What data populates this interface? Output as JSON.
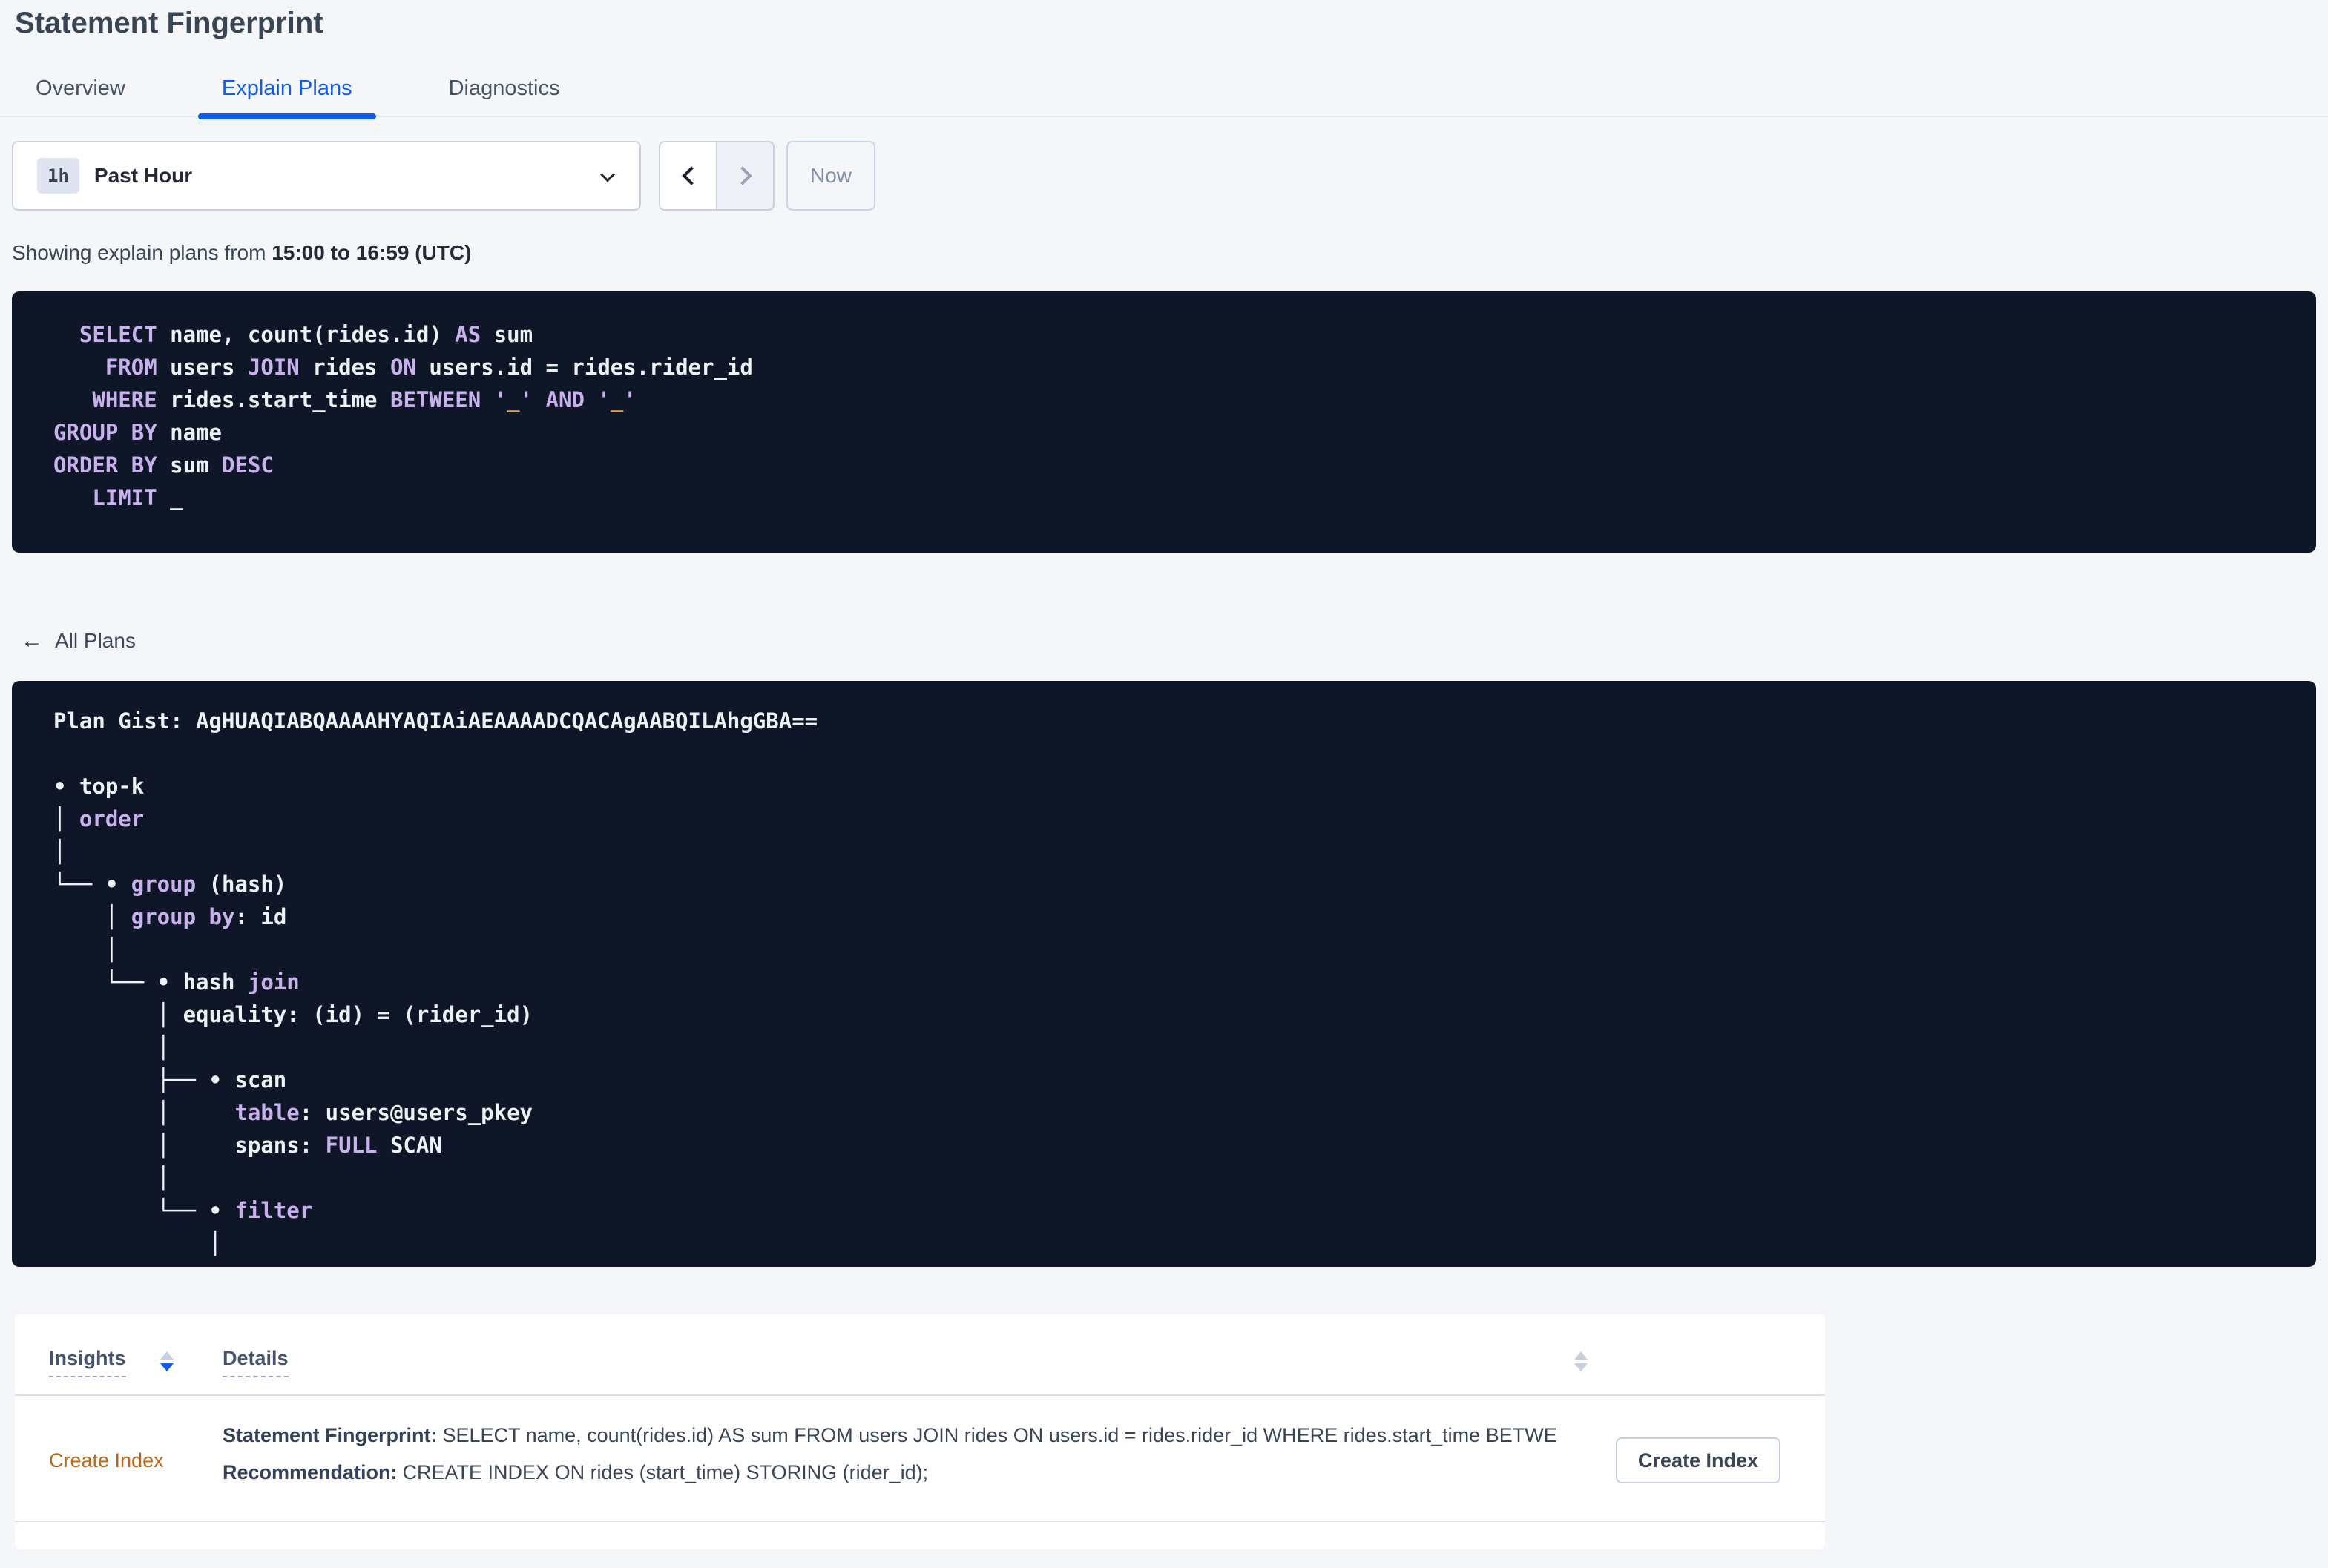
{
  "header": {
    "title": "Statement Fingerprint"
  },
  "tabs": [
    {
      "label": "Overview",
      "active": false
    },
    {
      "label": "Explain Plans",
      "active": true
    },
    {
      "label": "Diagnostics",
      "active": false
    }
  ],
  "toolbar": {
    "interval_badge": "1h",
    "interval_label": "Past Hour",
    "now_label": "Now"
  },
  "status_line": {
    "prefix": "Showing explain plans from ",
    "bold_range": "15:00 to 16:59 (UTC)"
  },
  "sql_block": {
    "lines": [
      [
        {
          "c": "p",
          "t": "  "
        },
        {
          "c": "k",
          "t": "SELECT"
        },
        {
          "c": "p",
          "t": " name, count(rides.id) "
        },
        {
          "c": "k",
          "t": "AS"
        },
        {
          "c": "p",
          "t": " sum"
        }
      ],
      [
        {
          "c": "p",
          "t": "    "
        },
        {
          "c": "k",
          "t": "FROM"
        },
        {
          "c": "p",
          "t": " users "
        },
        {
          "c": "k",
          "t": "JOIN"
        },
        {
          "c": "p",
          "t": " rides "
        },
        {
          "c": "k",
          "t": "ON"
        },
        {
          "c": "p",
          "t": " users.id = rides.rider_id"
        }
      ],
      [
        {
          "c": "p",
          "t": "   "
        },
        {
          "c": "k",
          "t": "WHERE"
        },
        {
          "c": "p",
          "t": " rides.start_time "
        },
        {
          "c": "k",
          "t": "BETWEEN"
        },
        {
          "c": "p",
          "t": " "
        },
        {
          "c": "k",
          "t": "'"
        },
        {
          "c": "o",
          "t": "_"
        },
        {
          "c": "k",
          "t": "'"
        },
        {
          "c": "p",
          "t": " "
        },
        {
          "c": "k",
          "t": "AND"
        },
        {
          "c": "p",
          "t": " "
        },
        {
          "c": "k",
          "t": "'"
        },
        {
          "c": "o",
          "t": "_"
        },
        {
          "c": "k",
          "t": "'"
        }
      ],
      [
        {
          "c": "k",
          "t": "GROUP BY"
        },
        {
          "c": "p",
          "t": " name"
        }
      ],
      [
        {
          "c": "k",
          "t": "ORDER BY"
        },
        {
          "c": "p",
          "t": " sum "
        },
        {
          "c": "k",
          "t": "DESC"
        }
      ],
      [
        {
          "c": "p",
          "t": "   "
        },
        {
          "c": "k",
          "t": "LIMIT"
        },
        {
          "c": "p",
          "t": " _"
        }
      ]
    ]
  },
  "nav": {
    "back_label": "All Plans"
  },
  "plan_block": {
    "lines": [
      [
        {
          "c": "p",
          "t": "Plan Gist: AgHUAQIABQAAAAHYAQIAiAEAAAADCQACAgAABQILAhgGBA=="
        }
      ],
      [],
      [
        {
          "c": "p",
          "t": "• top-k"
        }
      ],
      [
        {
          "c": "p",
          "t": "│ "
        },
        {
          "c": "k",
          "t": "order"
        }
      ],
      [
        {
          "c": "p",
          "t": "│"
        }
      ],
      [
        {
          "c": "p",
          "t": "└── • "
        },
        {
          "c": "k",
          "t": "group"
        },
        {
          "c": "p",
          "t": " (hash)"
        }
      ],
      [
        {
          "c": "p",
          "t": "    │ "
        },
        {
          "c": "k",
          "t": "group by"
        },
        {
          "c": "p",
          "t": ": id"
        }
      ],
      [
        {
          "c": "p",
          "t": "    │"
        }
      ],
      [
        {
          "c": "p",
          "t": "    └── • hash "
        },
        {
          "c": "k",
          "t": "join"
        }
      ],
      [
        {
          "c": "p",
          "t": "        │ equality: (id) = (rider_id)"
        }
      ],
      [
        {
          "c": "p",
          "t": "        │"
        }
      ],
      [
        {
          "c": "p",
          "t": "        ├── • scan"
        }
      ],
      [
        {
          "c": "p",
          "t": "        │     "
        },
        {
          "c": "k",
          "t": "table"
        },
        {
          "c": "p",
          "t": ": users@users_pkey"
        }
      ],
      [
        {
          "c": "p",
          "t": "        │     spans: "
        },
        {
          "c": "k",
          "t": "FULL"
        },
        {
          "c": "p",
          "t": " SCAN"
        }
      ],
      [
        {
          "c": "p",
          "t": "        │"
        }
      ],
      [
        {
          "c": "p",
          "t": "        └── • "
        },
        {
          "c": "k",
          "t": "filter"
        }
      ],
      [
        {
          "c": "p",
          "t": "            │"
        }
      ]
    ]
  },
  "insights": {
    "columns": [
      "Insights",
      "Details"
    ],
    "row": {
      "insight_type": "Create Index",
      "statement_label": "Statement Fingerprint:",
      "statement": "SELECT name, count(rides.id) AS sum FROM users JOIN rides ON users.id = rides.rider_id WHERE rides.start_time BETWEEN '_…",
      "recommendation_label": "Recommendation:",
      "recommendation": "CREATE INDEX ON rides (start_time) STORING (rider_id);",
      "action_label": "Create Index"
    }
  },
  "colors": {
    "accent_blue": "#0f5cf0",
    "keyword_lavender": "#c9b1ee",
    "literal_orange": "#f0a43a",
    "insight_orange": "#bd6714",
    "code_background": "#0e1627"
  }
}
